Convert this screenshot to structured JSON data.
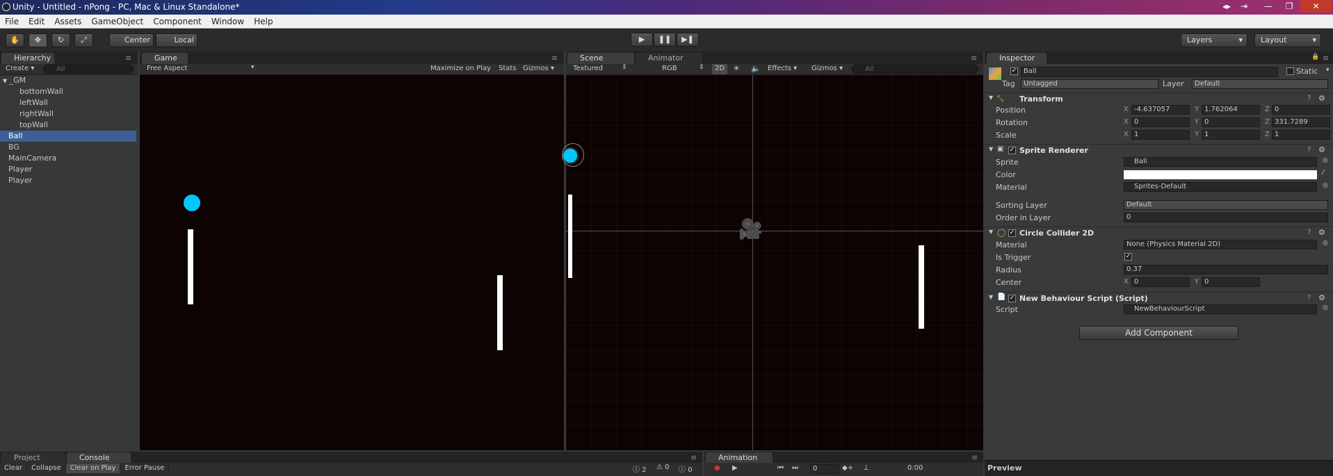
{
  "titlebar": {
    "title": "Unity - Untitled - nPong - PC, Mac & Linux Standalone*"
  },
  "menu": [
    "File",
    "Edit",
    "Assets",
    "GameObject",
    "Component",
    "Window",
    "Help"
  ],
  "toolbar": {
    "center": "Center",
    "local": "Local",
    "layers": "Layers",
    "layout": "Layout"
  },
  "hierarchy": {
    "tab": "Hierarchy",
    "create": "Create",
    "search_placeholder": "All",
    "items": [
      {
        "label": "_GM"
      },
      {
        "label": "bottomWall"
      },
      {
        "label": "leftWall"
      },
      {
        "label": "rightWall"
      },
      {
        "label": "topWall"
      },
      {
        "label": "Ball"
      },
      {
        "label": "BG"
      },
      {
        "label": "MainCamera"
      },
      {
        "label": "Player"
      },
      {
        "label": "Player"
      }
    ]
  },
  "game": {
    "tab": "Game",
    "aspect": "Free Aspect",
    "maximize": "Maximize on Play",
    "stats": "Stats",
    "gizmos": "Gizmos"
  },
  "scene": {
    "tab": "Scene",
    "animator_tab": "Animator",
    "textured": "Textured",
    "rgb": "RGB",
    "mode2d": "2D",
    "effects": "Effects",
    "gizmos": "Gizmos",
    "search_placeholder": "All"
  },
  "inspector": {
    "tab": "Inspector",
    "object_name": "Ball",
    "static": "Static",
    "tag_label": "Tag",
    "tag_value": "Untagged",
    "layer_label": "Layer",
    "layer_value": "Default",
    "transform": {
      "title": "Transform",
      "position_label": "Position",
      "pos_x": "-4.637057",
      "pos_y": "1.762064",
      "pos_z": "0",
      "rotation_label": "Rotation",
      "rot_x": "0",
      "rot_y": "0",
      "rot_z": "331.7289",
      "scale_label": "Scale",
      "scale_x": "1",
      "scale_y": "1",
      "scale_z": "1"
    },
    "sprite_renderer": {
      "title": "Sprite Renderer",
      "sprite_label": "Sprite",
      "sprite_value": "Ball",
      "color_label": "Color",
      "color_value": "#ffffff",
      "material_label": "Material",
      "material_value": "Sprites-Default",
      "sorting_label": "Sorting Layer",
      "sorting_value": "Default",
      "order_label": "Order in Layer",
      "order_value": "0"
    },
    "circle_collider": {
      "title": "Circle Collider 2D",
      "material_label": "Material",
      "material_value": "None (Physics Material 2D)",
      "trigger_label": "Is Trigger",
      "radius_label": "Radius",
      "radius_value": "0.37",
      "center_label": "Center",
      "center_x": "0",
      "center_y": "0"
    },
    "script": {
      "title": "New Behaviour Script (Script)",
      "script_label": "Script",
      "script_value": "NewBehaviourScript"
    },
    "add_component": "Add Component",
    "preview": "Preview"
  },
  "bottom": {
    "project_tab": "Project",
    "console_tab": "Console",
    "animation_tab": "Animation",
    "clear": "Clear",
    "collapse": "Collapse",
    "clear_on_play": "Clear on Play",
    "error_pause": "Error Pause",
    "log_count": "2",
    "warn_count": "0",
    "err_count": "0",
    "frame": "0",
    "time": "0:00"
  },
  "colors": {
    "ball": "#00c8ff",
    "view_bg": "#0e0303",
    "selection": "#3e5f96"
  }
}
